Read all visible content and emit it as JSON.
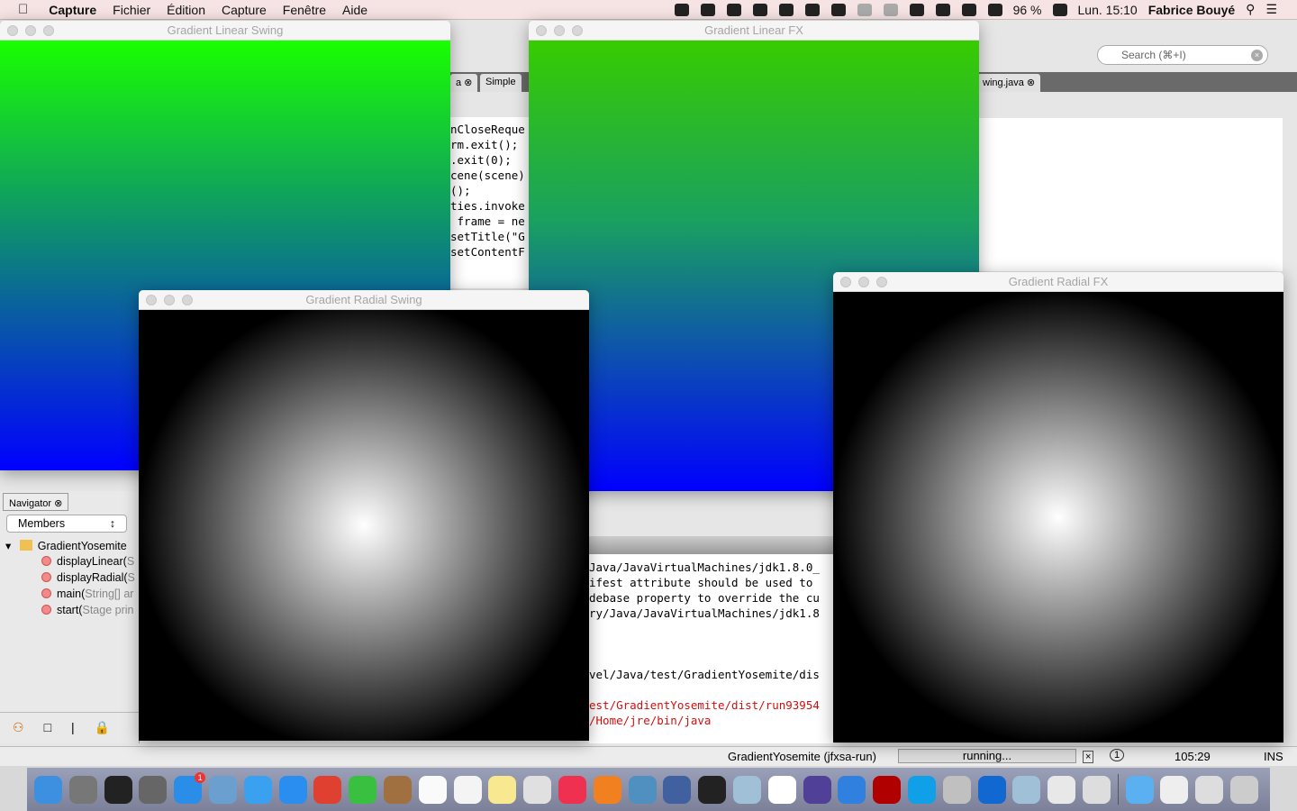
{
  "menubar": {
    "app": "Capture",
    "items": [
      "Fichier",
      "Édition",
      "Capture",
      "Fenêtre",
      "Aide"
    ],
    "battery": "96 %",
    "clock": "Lun. 15:10",
    "user": "Fabrice Bouyé",
    "status_icons": [
      "dropbox-icon",
      "google-drive-icon",
      "spiral-icon",
      "ghost-icon",
      "teamviewer-icon",
      "memory-icon",
      "display-icon",
      "time-machine-icon",
      "bluetooth-icon",
      "wifi-icon",
      "volume-icon",
      "battery-icon",
      "keyboard-icon"
    ]
  },
  "ide": {
    "search_placeholder": "Search (⌘+I)",
    "tabs": [
      "a",
      "Simple",
      "wing.java"
    ],
    "code": [
      "nCloseReque",
      "rm.exit();",
      ".exit(0);",
      "",
      "cene(scene)",
      "();",
      "ties.invoke",
      " frame = ne",
      "setTitle(\"G",
      "setContentF"
    ],
    "navigator": {
      "tab": "Navigator",
      "filter": "Members",
      "root": "GradientYosemite",
      "members": [
        {
          "name": "displayLinear(",
          "rest": "S"
        },
        {
          "name": "displayRadial(",
          "rest": "S"
        },
        {
          "name": "main(",
          "rest": "String[] ar"
        },
        {
          "name": "start(",
          "rest": "Stage prin"
        }
      ]
    },
    "output": {
      "lines": [
        "Java/JavaVirtualMachines/jdk1.8.0_",
        "ifest attribute should be used to",
        "debase property to override the cu",
        "ry/Java/JavaVirtualMachines/jdk1.8",
        "",
        "",
        "",
        "vel/Java/test/GradientYosemite/dis",
        ""
      ],
      "error_lines": [
        "est/GradientYosemite/dist/run93954",
        "/Home/jre/bin/java"
      ]
    },
    "status": {
      "task": "GradientYosemite (jfxsa-run)",
      "progress": "running...",
      "notifications": "1",
      "position": "105:29",
      "mode": "INS"
    }
  },
  "windows": {
    "linear_swing": "Gradient Linear Swing",
    "linear_fx": "Gradient Linear FX",
    "radial_swing": "Gradient Radial Swing",
    "radial_fx": "Gradient Radial FX"
  },
  "colors": {
    "linear_top": "#19ff00",
    "linear_bottom": "#0000ff",
    "radial_center": "#ffffff",
    "radial_edge": "#000000"
  },
  "dock": {
    "badge": "1",
    "apps": [
      [
        "finder-icon",
        "#3d8fe0"
      ],
      [
        "launchpad-icon",
        "#777"
      ],
      [
        "activity-icon",
        "#222"
      ],
      [
        "system-preferences-icon",
        "#666"
      ],
      [
        "app-store-icon",
        "#2a8ee8"
      ],
      [
        "preview-icon",
        "#6a9fd0"
      ],
      [
        "messages-icon",
        "#3aa0f0"
      ],
      [
        "safari-icon",
        "#2a8ef0"
      ],
      [
        "chrome-icon",
        "#e04030"
      ],
      [
        "facetime-icon",
        "#3ac040"
      ],
      [
        "contacts-icon",
        "#a07040"
      ],
      [
        "calendar-icon",
        "#fafafa"
      ],
      [
        "reminders-icon",
        "#f4f4f4"
      ],
      [
        "notes-icon",
        "#f8e890"
      ],
      [
        "photos-icon",
        "#e0e0e0"
      ],
      [
        "itunes-icon",
        "#f03050"
      ],
      [
        "ibooks-icon",
        "#f08020"
      ],
      [
        "iphoto-icon",
        "#5090c0"
      ],
      [
        "virtualbox-icon",
        "#4060a0"
      ],
      [
        "terminal-icon",
        "#222"
      ],
      [
        "cube-icon",
        "#a0c0d8"
      ],
      [
        "hand-icon",
        "#fff"
      ],
      [
        "eclipse-icon",
        "#504098"
      ],
      [
        "xcode-icon",
        "#3080e0"
      ],
      [
        "filezilla-icon",
        "#b00000"
      ],
      [
        "skype-icon",
        "#10a0e8"
      ],
      [
        "bootcamp-icon",
        "#c0c0c0"
      ],
      [
        "teamviewer-icon",
        "#1068d0"
      ],
      [
        "cube2-icon",
        "#a0c0d8"
      ],
      [
        "java-icon",
        "#e8e8e8"
      ],
      [
        "scissors-icon",
        "#ddd"
      ],
      [
        "sep",
        ""
      ],
      [
        "downloads-folder-icon",
        "#5ab0f0"
      ],
      [
        "document-icon",
        "#eee"
      ],
      [
        "screenshot-icon",
        "#ddd"
      ],
      [
        "trash-icon",
        "#ccc"
      ]
    ]
  }
}
